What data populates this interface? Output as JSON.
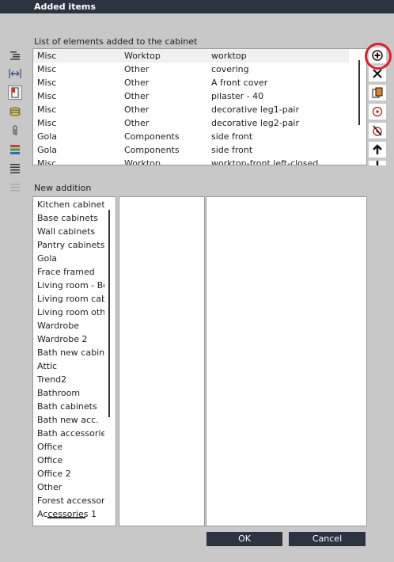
{
  "window": {
    "title": "Added items"
  },
  "cabinet": {
    "section_label": "List of elements added to the cabinet",
    "rows": [
      [
        "Misc",
        "Worktop",
        "worktop"
      ],
      [
        "Misc",
        "Other",
        "covering"
      ],
      [
        "Misc",
        "Other",
        "A front cover"
      ],
      [
        "Misc",
        "Other",
        "pilaster - 40"
      ],
      [
        "Misc",
        "Other",
        "decorative leg1-pair"
      ],
      [
        "Misc",
        "Other",
        "decorative leg2-pair"
      ],
      [
        "Gola",
        "Components",
        "side front"
      ],
      [
        "Gola",
        "Components",
        "side front"
      ],
      [
        "Misc",
        "Worktop",
        "worktop-front left-closed"
      ]
    ]
  },
  "left_tools": [
    "list-indent-icon",
    "width-arrows-icon",
    "cabinet-door-icon",
    "layers-stack-icon",
    "paperclip-icon",
    "color-bars-icon",
    "lines-icon",
    "lines-gray-icon"
  ],
  "right_tools": [
    "add-circle-icon",
    "remove-x-icon",
    "copy-icon",
    "target-icon",
    "strike-target-icon",
    "arrow-up-icon"
  ],
  "new_addition": {
    "section_label": "New addition",
    "categories": [
      "Kitchen cabinets",
      "Base cabinets",
      "Wall cabinets",
      "Pantry cabinets",
      "Gola",
      "Frace framed",
      "Living room - Be...",
      "Living room cabi...",
      "Living room other",
      "Wardrobe",
      "Wardrobe 2",
      "Bath new cabin...",
      "Attic",
      "Trend2",
      "Bathroom",
      "Bath cabinets",
      "Bath new acc.",
      "Bath accessories",
      "Office",
      "Office",
      "Office 2",
      "Other",
      "Forest accessori...",
      "Accessories 1"
    ]
  },
  "buttons": {
    "ok": "OK",
    "cancel": "Cancel"
  },
  "colors": {
    "titlebar": "#2b3440",
    "highlight": "#e01e2a"
  }
}
